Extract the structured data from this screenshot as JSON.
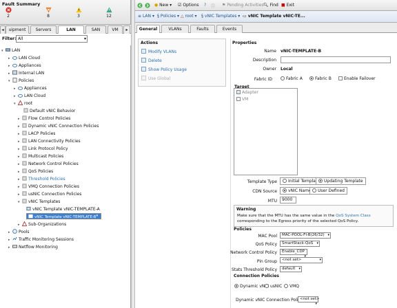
{
  "fault_summary": {
    "title": "Fault Summary",
    "counts": [
      {
        "icon": "critical-icon",
        "value": "2"
      },
      {
        "icon": "major-icon",
        "value": "8"
      },
      {
        "icon": "minor-icon",
        "value": "3"
      },
      {
        "icon": "warning-icon",
        "value": "12"
      }
    ]
  },
  "left_tabs": [
    "uipment",
    "Servers",
    "LAN",
    "SAN",
    "VM"
  ],
  "filter": {
    "label": "Filter:",
    "value": "All"
  },
  "tree": {
    "lan": "LAN",
    "lan_cloud": "LAN Cloud",
    "appliances": "Appliances",
    "internal_lan": "Internal LAN",
    "policies": "Policies",
    "p_appliances": "Appliances",
    "p_lan_cloud": "LAN Cloud",
    "root": "root",
    "default_vnic": "Default vNIC Behavior",
    "flow_control": "Flow Control Policies",
    "dyn_vnic": "Dynamic vNIC Connection Policies",
    "lacp": "LACP Policies",
    "lan_conn": "LAN Connectivity Policies",
    "link_proto": "Link Protocol Policy",
    "multicast": "Multicast Policies",
    "net_ctrl": "Network Control Policies",
    "qos": "QoS Policies",
    "threshold": "Threshold Policies",
    "vmq": "VMQ Connection Policies",
    "usnic": "usNIC Connection Policies",
    "vnic_templates": "vNIC Templates",
    "tmpl_a": "vNIC Template vNIC-TEMPLATE-A",
    "tmpl_b": "vNIC Template vNIC-TEMPLATE-B",
    "sub_orgs": "Sub-Organizations",
    "pools": "Pools",
    "traffic": "Traffic Monitoring Sessions",
    "netflow": "Netflow Monitoring"
  },
  "toolbar": {
    "new": "New",
    "options": "Options",
    "pending": "Pending Activities",
    "find": "Find",
    "exit": "Exit"
  },
  "breadcrumb": {
    "lan": "LAN",
    "policies": "Policies",
    "root": "root",
    "vnic_templates": "vNIC Templates",
    "current": "vNIC Template vNIC-TE..."
  },
  "right_tabs": [
    "General",
    "VLANs",
    "Faults",
    "Events"
  ],
  "actions": {
    "title": "Actions",
    "modify_vlans": "Modify VLANs",
    "delete": "Delete",
    "show_policy": "Show Policy Usage",
    "use_global": "Use Global"
  },
  "properties": {
    "title": "Properties",
    "name_label": "Name",
    "name_value": "vNIC-TEMPLATE-B",
    "description_label": "Description",
    "description_value": "",
    "owner_label": "Owner",
    "owner_value": "Local",
    "fabric_label": "Fabric ID",
    "fabric_a": "Fabric A",
    "fabric_b": "Fabric B",
    "enable_failover": "Enable Failover",
    "target_label": "Target",
    "target_adapter": "Adapter",
    "target_vm": "VM",
    "template_type_label": "Template Type",
    "initial_template": "Initial Template",
    "updating_template": "Updating Template",
    "cdn_label": "CDN Source",
    "vnic_name": "vNIC Name",
    "user_defined": "User Defined",
    "mtu_label": "MTU",
    "mtu_value": "9000",
    "warning_title": "Warning",
    "warning_text1": "Make sure that the MTU has the same value in the",
    "warning_link": "QoS System Class",
    "warning_text2": "corresponding to the Egress priority of the selected QoS Policy.",
    "policies_title": "Policies",
    "mac_pool_label": "MAC Pool",
    "mac_pool_value": "MAC-POOL-FI-B(26/32)",
    "qos_label": "QoS Policy",
    "qos_value": "SmartStack-QoS",
    "net_ctrl_label": "Network Control Policy",
    "net_ctrl_value": "Enable_CDP",
    "pin_group_label": "Pin Group",
    "pin_group_value": "<not set>",
    "stats_label": "Stats Threshold Policy",
    "stats_value": "default",
    "conn_policies_title": "Connection Policies",
    "dynamic_vnic": "Dynamic vNIC",
    "usnic": "usNIC",
    "vmq": "VMQ",
    "dyn_conn_label": "Dynamic vNIC Connection Policy",
    "dyn_conn_value": "<not set>"
  }
}
